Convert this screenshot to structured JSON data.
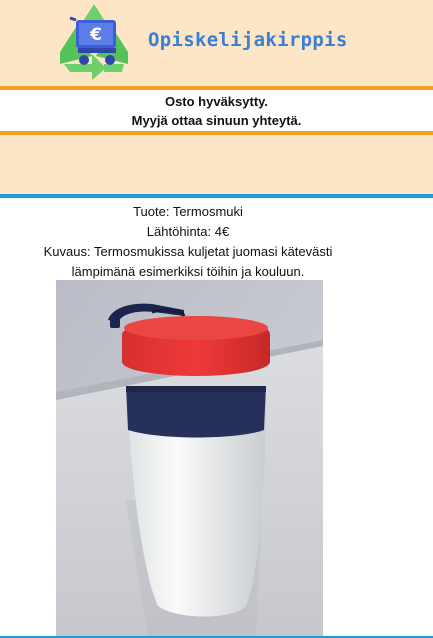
{
  "header": {
    "site_title": "Opiskelijakirppis",
    "logo_icon": "recycle-cart-euro-icon",
    "logo_symbol": "€"
  },
  "notice": {
    "line1": "Osto hyväksytty.",
    "line2": "Myyjä ottaa sinuun yhteytä."
  },
  "product": {
    "name_line": "Tuote: Termosmuki",
    "price_line": "Lähtöhinta: 4€",
    "description_line1": "Kuvaus: Termosmukissa kuljetat juomasi kätevästi",
    "description_line2": "lämpimänä esimerkiksi töihin ja kouluun.",
    "image_icon": "thermos-mug-photo"
  },
  "colors": {
    "header_bg": "#fde6c6",
    "accent_orange": "#f4a21d",
    "accent_blue": "#1e9be0",
    "title_blue": "#3a7fd5"
  }
}
